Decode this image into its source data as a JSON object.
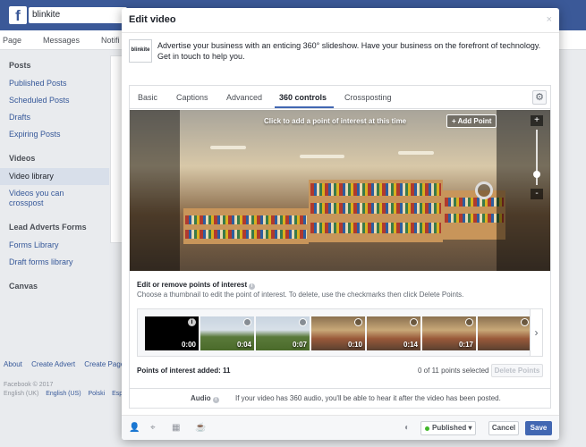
{
  "topbar": {
    "logo": "f",
    "search_value": "blinkite"
  },
  "page_nav": {
    "items": [
      "Page",
      "Messages",
      "Notifi"
    ]
  },
  "sidebar": {
    "sections": [
      {
        "heading": "Posts",
        "items": [
          "Published Posts",
          "Scheduled Posts",
          "Drafts",
          "Expiring Posts"
        ]
      },
      {
        "heading": "Videos",
        "items": [
          "Video library",
          "Videos you can crosspost"
        ]
      },
      {
        "heading": "Lead Adverts Forms",
        "items": [
          "Forms Library",
          "Draft forms library"
        ]
      },
      {
        "heading": "Canvas",
        "items": []
      }
    ],
    "active_item": "Video library"
  },
  "footer": {
    "links": [
      "About",
      "Create Advert",
      "Create Page"
    ],
    "copyright": "Facebook © 2017",
    "languages": [
      "English (UK)",
      "English (US)",
      "Polski",
      "Esp"
    ]
  },
  "modal": {
    "title": "Edit video",
    "close": "×",
    "promo": {
      "logo_text": "blinkite",
      "text": "Advertise your business with an enticing 360° slideshow. Have your business on the forefront of technology. Get in touch to help you."
    },
    "tabs": [
      "Basic",
      "Captions",
      "Advanced",
      "360 controls",
      "Crossposting"
    ],
    "active_tab": "360 controls",
    "viewer": {
      "hint": "Click to add a point of interest at this time",
      "add_point": "+ Add Point",
      "zoom_in": "+",
      "zoom_out": "-"
    },
    "poi": {
      "title": "Edit or remove points of interest",
      "info": "i",
      "desc": "Choose a thumbnail to edit the point of interest. To delete, use the checkmarks then click Delete Points.",
      "thumbnails": [
        {
          "time": "0:00",
          "scene": "black"
        },
        {
          "time": "0:04",
          "scene": "outdoor"
        },
        {
          "time": "0:07",
          "scene": "outdoor"
        },
        {
          "time": "0:10",
          "scene": "indoor"
        },
        {
          "time": "0:14",
          "scene": "indoor"
        },
        {
          "time": "0:17",
          "scene": "indoor"
        },
        {
          "time": "",
          "scene": "indoor"
        }
      ],
      "next": "›"
    },
    "points_added": "Points of interest added: 11",
    "points_selected": "0 of 11 points selected",
    "delete_points": "Delete Points",
    "audio": {
      "label": "Audio",
      "info": "i",
      "desc": "If your video has 360 audio, you'll be able to hear it after the video has been posted."
    },
    "footer": {
      "published": "Published ▾",
      "cancel": "Cancel",
      "save": "Save"
    }
  }
}
